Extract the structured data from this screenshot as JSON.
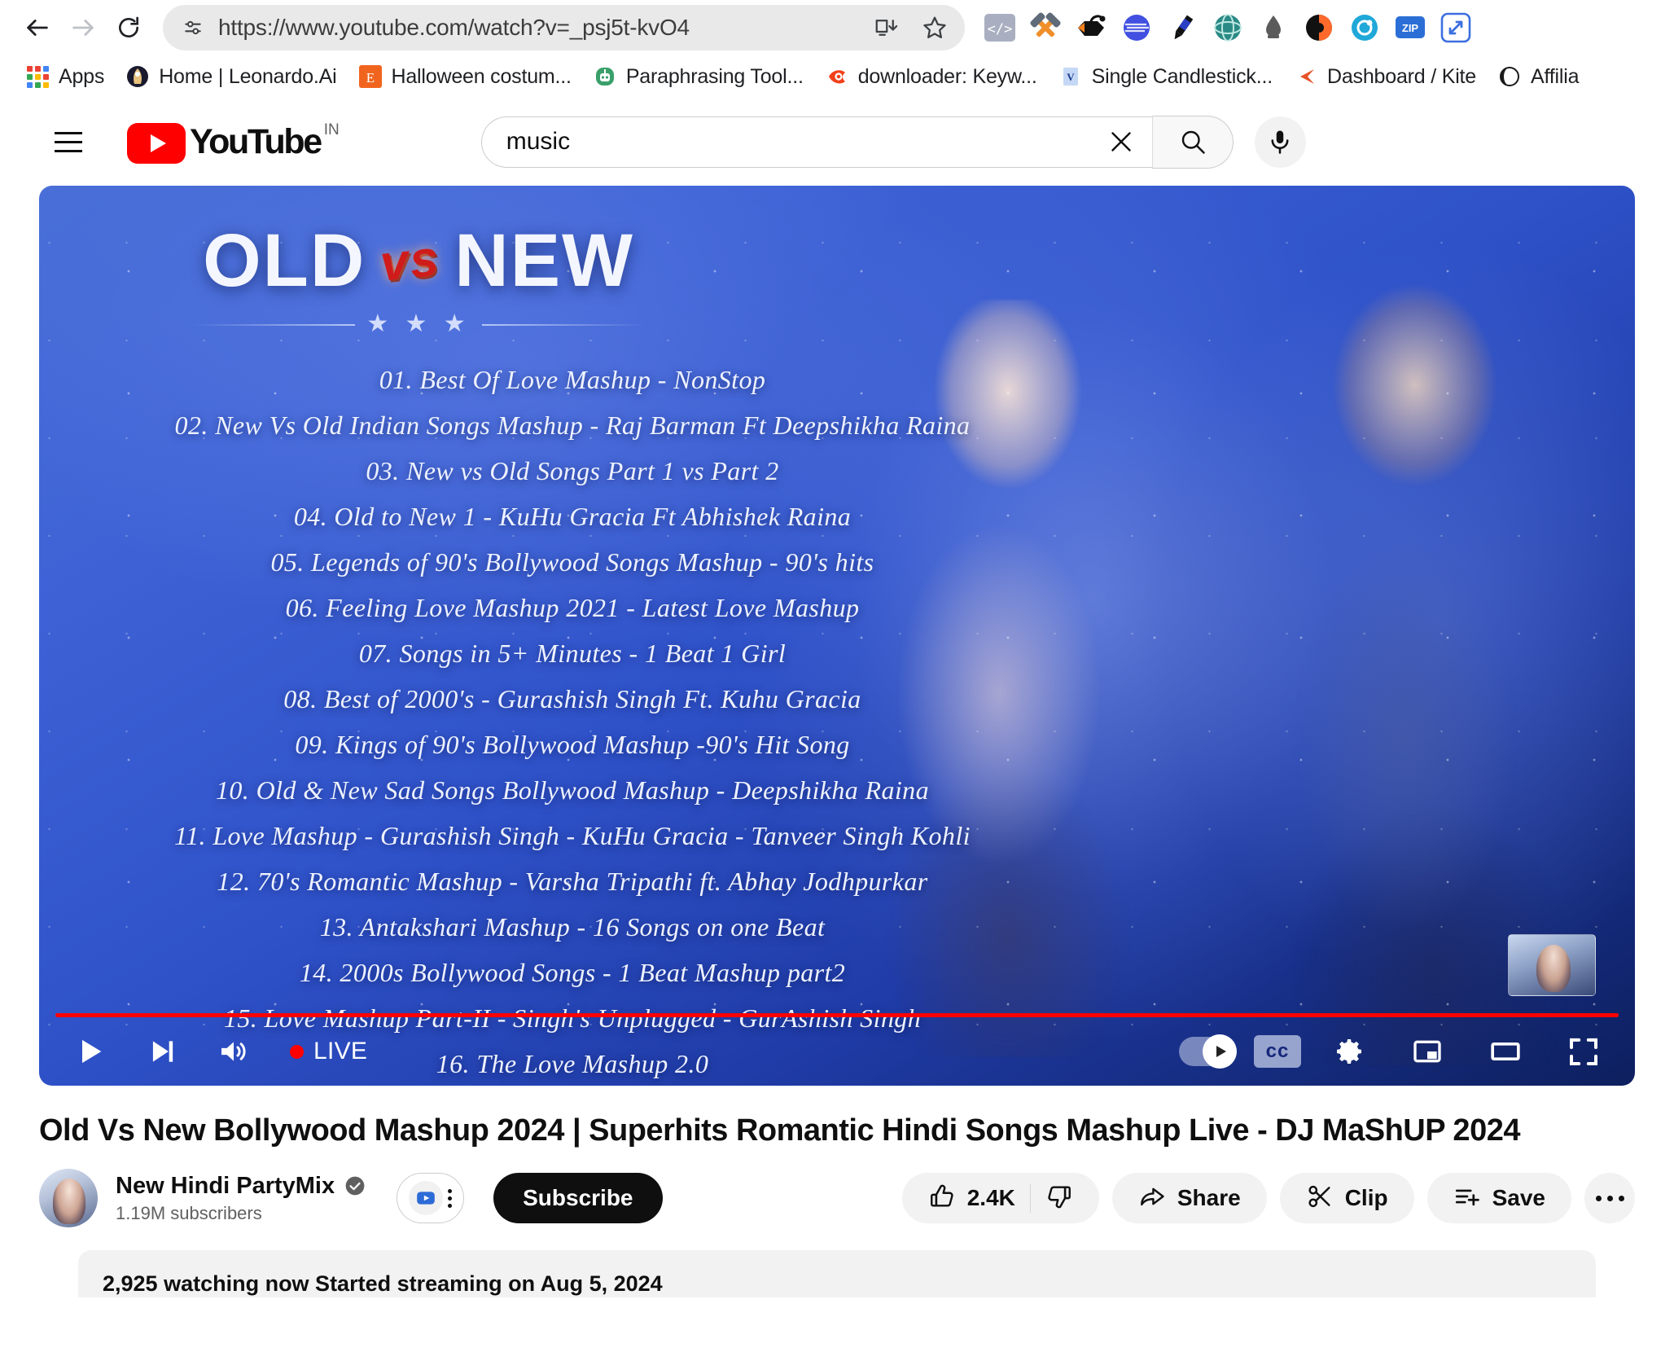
{
  "browser": {
    "nav": {
      "back": "back-arrow",
      "forward": "forward-arrow",
      "reload": "reload-arrow"
    },
    "omnibox": {
      "url": "https://www.youtube.com/watch?v=_psj5t-kvO4",
      "site_info_icon": "tune-icon",
      "install_icon": "install-app-icon",
      "bookmark_icon": "star-outline-icon"
    },
    "extensions": [
      {
        "name": "code-brackets-extension",
        "glyph": "</>",
        "color": "#a9afc0"
      },
      {
        "name": "hammers-tools-extension",
        "glyph": "",
        "color": "#ef8f2a"
      },
      {
        "name": "black-ninja-extension",
        "glyph": "",
        "color": "#111111"
      },
      {
        "name": "blue-sphere-extension",
        "glyph": "",
        "color": "#4150e0"
      },
      {
        "name": "pen-highlighter-extension",
        "glyph": "",
        "color": "#2b3ec4"
      },
      {
        "name": "globe-teal-extension",
        "glyph": "",
        "color": "#2b8a86"
      },
      {
        "name": "ink-drop-extension",
        "glyph": "",
        "color": "#4a4a4a"
      },
      {
        "name": "orange-swirl-extension",
        "glyph": "",
        "color": "#ff6a2b"
      },
      {
        "name": "cyan-circle-extension",
        "glyph": "",
        "color": "#1fa8d8"
      },
      {
        "name": "zip-extension",
        "glyph": "ZIP",
        "color": "#2b6fd6"
      },
      {
        "name": "expand-arrows-extension",
        "glyph": "",
        "color": "#3b6fe0"
      }
    ],
    "bookmarks": [
      {
        "label": "Apps",
        "icon": "apps-grid-icon"
      },
      {
        "label": "Home | Leonardo.Ai",
        "icon": "leonardo-icon"
      },
      {
        "label": "Halloween costum...",
        "icon": "etsy-icon"
      },
      {
        "label": "Paraphrasing Tool...",
        "icon": "quillbot-icon"
      },
      {
        "label": "downloader: Keyw...",
        "icon": "fire-eye-icon"
      },
      {
        "label": "Single Candlestick...",
        "icon": "v-book-icon"
      },
      {
        "label": "Dashboard / Kite",
        "icon": "kite-icon"
      },
      {
        "label": "Affilia",
        "icon": "globe-dark-icon"
      }
    ]
  },
  "youtube": {
    "header": {
      "menu_icon": "hamburger-menu-icon",
      "logo_text": "YouTube",
      "country_code": "IN",
      "search_value": "music",
      "search_placeholder": "Search",
      "clear_icon": "close-x-icon",
      "search_icon": "magnifier-icon",
      "mic_icon": "microphone-icon"
    },
    "player": {
      "overlay_title_old": "OLD",
      "overlay_title_vs": "vs",
      "overlay_title_new": "NEW",
      "stars": "★ ★ ★",
      "tracklist": [
        "01. Best Of Love Mashup - NonStop",
        "02. New Vs Old Indian Songs Mashup - Raj Barman Ft Deepshikha Raina",
        "03. New vs Old Songs Part 1 vs Part 2",
        "04. Old to New 1 - KuHu Gracia Ft Abhishek Raina",
        "05. Legends of 90's Bollywood Songs Mashup - 90's hits",
        "06. Feeling Love Mashup 2021 - Latest Love Mashup",
        "07. Songs in 5+ Minutes - 1 Beat 1 Girl",
        "08. Best of 2000's - Gurashish Singh Ft. Kuhu Gracia",
        "09. Kings of 90's Bollywood Mashup -90's Hit Song",
        "10. Old & New Sad Songs Bollywood Mashup - Deepshikha Raina",
        "11. Love Mashup - Gurashish Singh - KuHu Gracia - Tanveer Singh Kohli",
        "12. 70's Romantic Mashup - Varsha Tripathi ft. Abhay Jodhpurkar",
        "13. Antakshari Mashup - 16 Songs on one Beat",
        "14. 2000s Bollywood Songs - 1 Beat Mashup part2",
        "15. Love Mashup Part-II - Singh's Unplugged - GurAshish Singh",
        "16. The Love Mashup 2.0"
      ],
      "controls": {
        "play_icon": "play-icon",
        "next_icon": "next-track-icon",
        "volume_icon": "volume-icon",
        "live_label": "LIVE",
        "autoplay_icon": "autoplay-toggle",
        "captions_label": "cc",
        "settings_icon": "gear-icon",
        "miniplayer_icon": "miniplayer-icon",
        "theater_icon": "theater-mode-icon",
        "fullscreen_icon": "fullscreen-icon"
      },
      "progress_percent": 100,
      "progress_color": "#ff0000"
    },
    "video": {
      "title": "Old Vs New Bollywood Mashup 2024 | Superhits Romantic Hindi Songs Mashup Live - DJ MaShUP 2024",
      "channel_name": "New Hindi PartyMix",
      "verified_icon": "verified-badge-icon",
      "subscribers": "1.19M subscribers",
      "sponsor_icon": "sponsor-badge-icon",
      "sponsor_kebab_icon": "vertical-dots-icon",
      "subscribe_label": "Subscribe",
      "actions": {
        "like_count": "2.4K",
        "like_icon": "thumbs-up-icon",
        "dislike_icon": "thumbs-down-icon",
        "share_label": "Share",
        "share_icon": "share-arrow-icon",
        "clip_label": "Clip",
        "clip_icon": "scissors-icon",
        "save_label": "Save",
        "save_icon": "save-list-icon",
        "more_icon": "horizontal-dots-icon"
      },
      "stats_line": "2,925 watching now  Started streaming on Aug 5, 2024"
    }
  }
}
